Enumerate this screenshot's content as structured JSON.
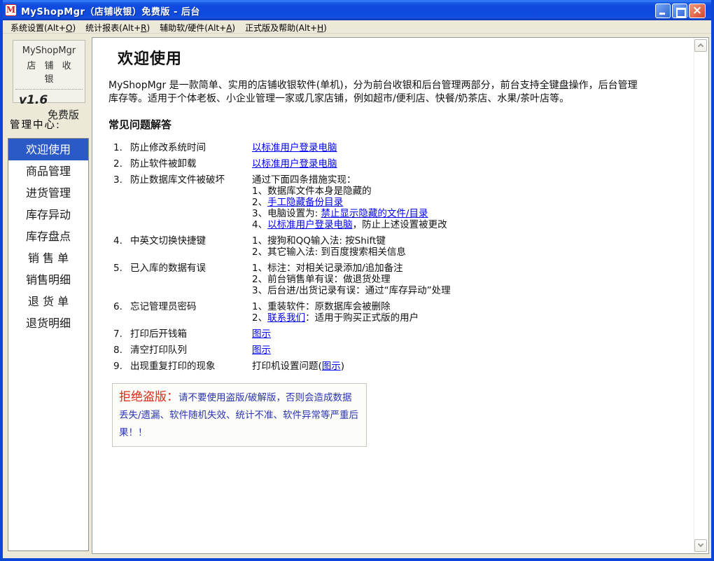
{
  "window": {
    "title": "MyShopMgr（店铺收银）免费版 - 后台",
    "icon_letter": "M"
  },
  "menu": {
    "items": [
      {
        "pre": "系统设置(Alt+",
        "key": "O",
        "post": ")"
      },
      {
        "pre": "统计报表(Alt+",
        "key": "R",
        "post": ")"
      },
      {
        "pre": "辅助软/硬件(Alt+",
        "key": "A",
        "post": ")"
      },
      {
        "pre": "正式版及帮助(Alt+",
        "key": "H",
        "post": ")"
      }
    ]
  },
  "sidebar": {
    "logo": {
      "name": "MyShopMgr",
      "subtitle": "店 铺 收 银",
      "version": "v1.6",
      "edition": "免费版"
    },
    "section_label": "管理中心:",
    "items": [
      {
        "label": "欢迎使用",
        "active": true
      },
      {
        "label": "商品管理",
        "active": false
      },
      {
        "label": "进货管理",
        "active": false
      },
      {
        "label": "库存异动",
        "active": false
      },
      {
        "label": "库存盘点",
        "active": false
      },
      {
        "label": "销 售 单",
        "active": false
      },
      {
        "label": "销售明细",
        "active": false
      },
      {
        "label": "退 货 单",
        "active": false
      },
      {
        "label": "退货明细",
        "active": false
      }
    ]
  },
  "main": {
    "welcome_title": "欢迎使用",
    "intro": "MyShopMgr 是一款简单、实用的店铺收银软件(单机)，分为前台收银和后台管理两部分，前台支持全键盘操作，后台管理库存等。适用于个体老板、小企业管理一家或几家店铺，例如超市/便利店、快餐/奶茶店、水果/茶叶店等。",
    "faq_title": "常见问题解答",
    "faq": [
      {
        "num": "1.",
        "question": "防止修改系统时间",
        "answers": [
          [
            {
              "text": "以标准用户登录电脑",
              "link": true
            }
          ]
        ]
      },
      {
        "num": "2.",
        "question": "防止软件被卸载",
        "answers": [
          [
            {
              "text": "以标准用户登录电脑",
              "link": true
            }
          ]
        ]
      },
      {
        "num": "3.",
        "question": "防止数据库文件被破坏",
        "answers": [
          [
            {
              "text": "通过下面四条措施实现："
            }
          ],
          [
            {
              "text": "1、数据库文件本身是隐藏的"
            }
          ],
          [
            {
              "text": "2、"
            },
            {
              "text": "手工隐藏备份目录",
              "link": true
            }
          ],
          [
            {
              "text": "3、电脑设置为: "
            },
            {
              "text": "禁止显示隐藏的文件/目录",
              "link": true
            }
          ],
          [
            {
              "text": "4、"
            },
            {
              "text": "以标准用户登录电脑",
              "link": true
            },
            {
              "text": "，防止上述设置被更改"
            }
          ]
        ]
      },
      {
        "num": "4.",
        "question": "中英文切换快捷键",
        "answers": [
          [
            {
              "text": "1、搜狗和QQ输入法: 按Shift键"
            }
          ],
          [
            {
              "text": "2、其它输入法: 到百度搜索相关信息"
            }
          ]
        ]
      },
      {
        "num": "5.",
        "question": "已入库的数据有误",
        "answers": [
          [
            {
              "text": "1、标注：对相关记录添加/追加备注"
            }
          ],
          [
            {
              "text": "2、前台销售单有误：做退货处理"
            }
          ],
          [
            {
              "text": "3、后台进/出货记录有误：通过“库存异动”处理"
            }
          ]
        ]
      },
      {
        "num": "6.",
        "question": "忘记管理员密码",
        "answers": [
          [
            {
              "text": "1、重装软件：原数据库会被删除"
            }
          ],
          [
            {
              "text": "2、"
            },
            {
              "text": "联系我们",
              "link": true
            },
            {
              "text": "：适用于购买正式版的用户"
            }
          ]
        ]
      },
      {
        "num": "7.",
        "question": "打印后开钱箱",
        "answers": [
          [
            {
              "text": "图示",
              "link": true
            }
          ]
        ]
      },
      {
        "num": "8.",
        "question": "清空打印队列",
        "answers": [
          [
            {
              "text": "图示",
              "link": true
            }
          ]
        ]
      },
      {
        "num": "9.",
        "question": "出现重复打印的现象",
        "answers": [
          [
            {
              "text": "打印机设置问题("
            },
            {
              "text": "图示",
              "link": true
            },
            {
              "text": ")"
            }
          ]
        ]
      }
    ],
    "piracy_notice": {
      "label": "拒绝盗版：",
      "text": "请不要使用盗版/破解版，否则会造成数据丢失/遗漏、软件随机失效、统计不准、软件异常等严重后果！！"
    }
  },
  "colors": {
    "titlebar_blue": "#0F4ADE",
    "selection_blue": "#2B59C6",
    "link_blue": "#0000EE",
    "warning_red": "#DE2A17",
    "notice_blue": "#2B35B0",
    "chrome_tan": "#ECE9D8"
  }
}
